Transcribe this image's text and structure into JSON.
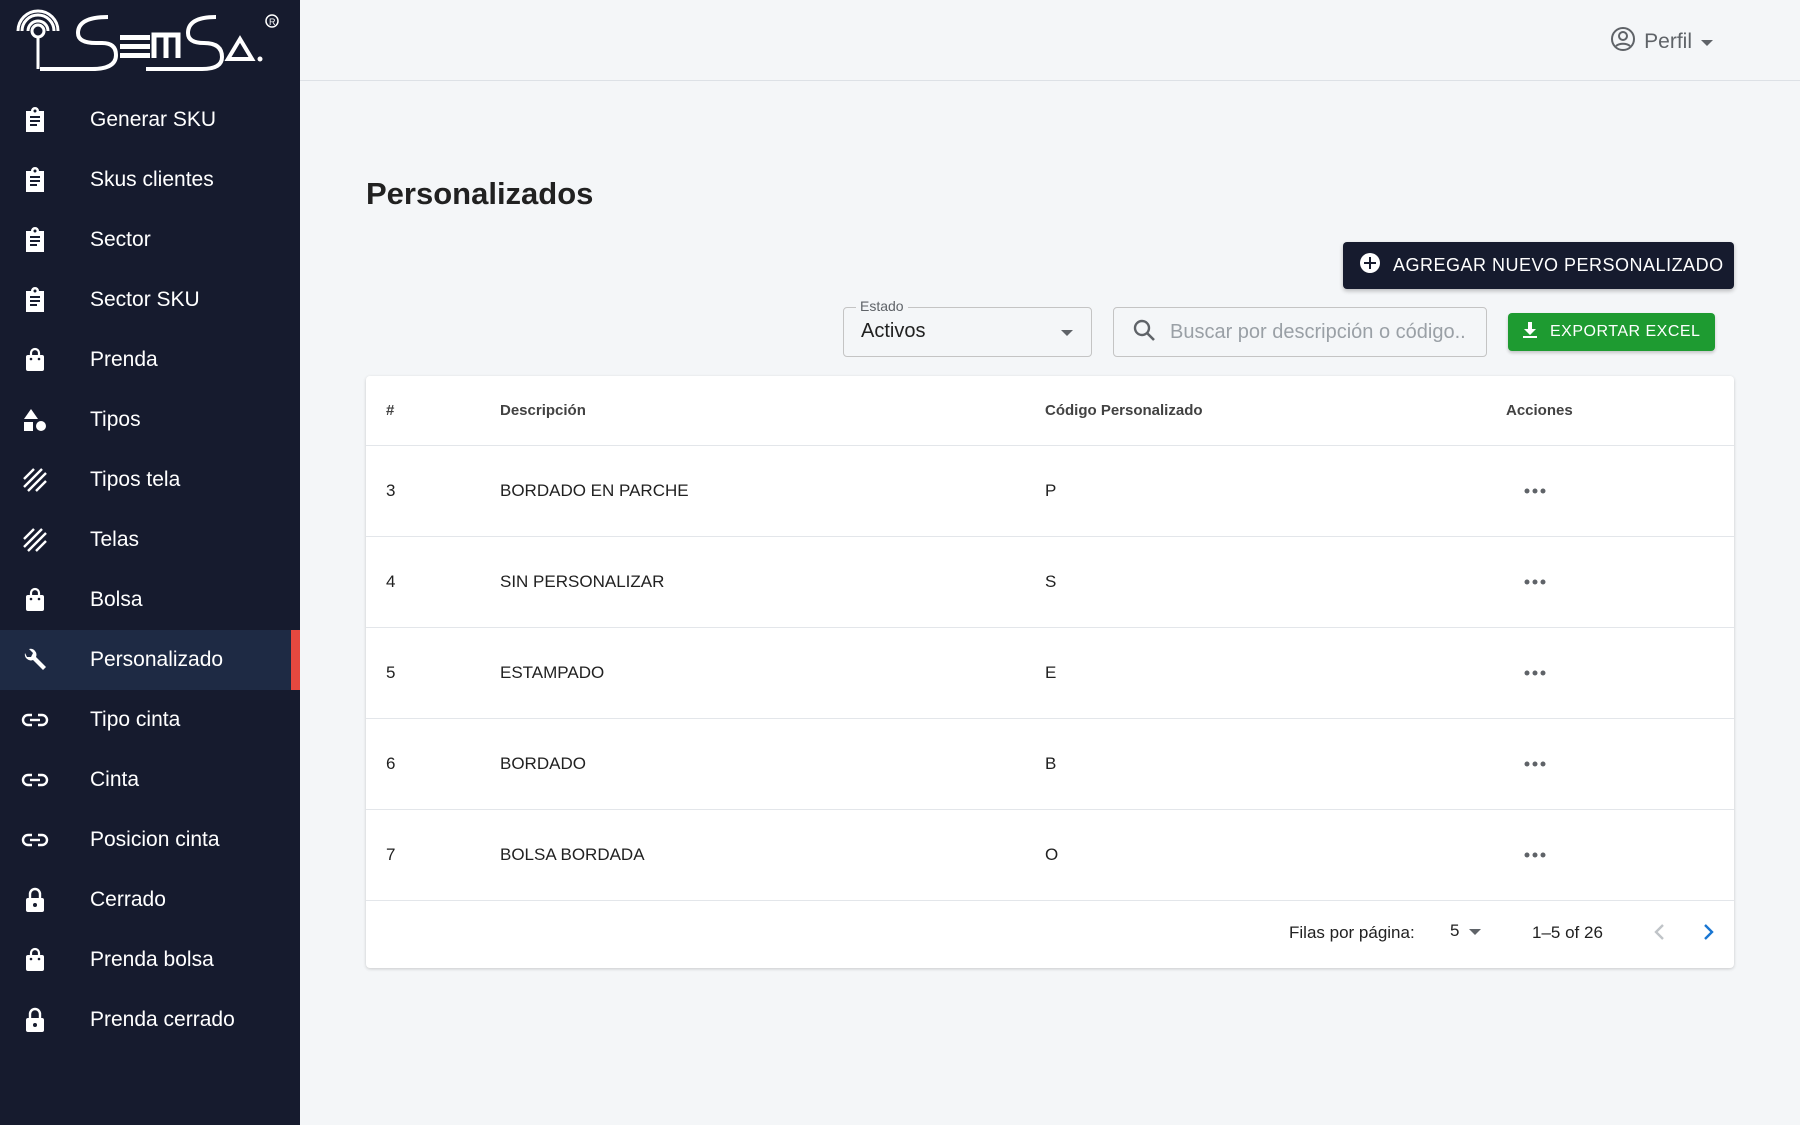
{
  "sidebar": {
    "logo_text": "SEMSA",
    "items": [
      {
        "label": "Generar SKU",
        "icon": "clipboard-icon"
      },
      {
        "label": "Skus clientes",
        "icon": "clipboard-icon"
      },
      {
        "label": "Sector",
        "icon": "clipboard-icon"
      },
      {
        "label": "Sector SKU",
        "icon": "clipboard-icon"
      },
      {
        "label": "Prenda",
        "icon": "shopping-bag-icon"
      },
      {
        "label": "Tipos",
        "icon": "category-shapes-icon"
      },
      {
        "label": "Tipos tela",
        "icon": "texture-icon"
      },
      {
        "label": "Telas",
        "icon": "texture-icon"
      },
      {
        "label": "Bolsa",
        "icon": "shopping-bag-icon"
      },
      {
        "label": "Personalizado",
        "icon": "wrench-icon",
        "active": true
      },
      {
        "label": "Tipo cinta",
        "icon": "link-icon"
      },
      {
        "label": "Cinta",
        "icon": "link-icon"
      },
      {
        "label": "Posicion cinta",
        "icon": "link-icon"
      },
      {
        "label": "Cerrado",
        "icon": "lock-icon"
      },
      {
        "label": "Prenda bolsa",
        "icon": "shopping-bag-icon"
      },
      {
        "label": "Prenda cerrado",
        "icon": "lock-icon"
      }
    ],
    "active_color": "#e5483f"
  },
  "header": {
    "profile_label": "Perfil"
  },
  "main": {
    "title": "Personalizados",
    "add_button_label": "AGREGAR NUEVO PERSONALIZADO",
    "estado": {
      "label": "Estado",
      "value": "Activos"
    },
    "search": {
      "placeholder": "Buscar por descripción o código.."
    },
    "export_button_label": "EXPORTAR EXCEL",
    "table": {
      "columns": {
        "num": "#",
        "desc": "Descripción",
        "code": "Código Personalizado",
        "actions": "Acciones"
      },
      "rows": [
        {
          "num": "3",
          "desc": "BORDADO EN PARCHE",
          "code": "P"
        },
        {
          "num": "4",
          "desc": "SIN PERSONALIZAR",
          "code": "S"
        },
        {
          "num": "5",
          "desc": "ESTAMPADO",
          "code": "E"
        },
        {
          "num": "6",
          "desc": "BORDADO",
          "code": "B"
        },
        {
          "num": "7",
          "desc": "BOLSA BORDADA",
          "code": "O"
        }
      ]
    },
    "pagination": {
      "rows_per_page_label": "Filas por página:",
      "rows_per_page": "5",
      "range": "1–5 of 26"
    }
  },
  "colors": {
    "sidebar_bg": "#161b2e",
    "export_green": "#1e9b31",
    "primary_dark": "#161b2e",
    "pager_next": "#1976d2"
  }
}
